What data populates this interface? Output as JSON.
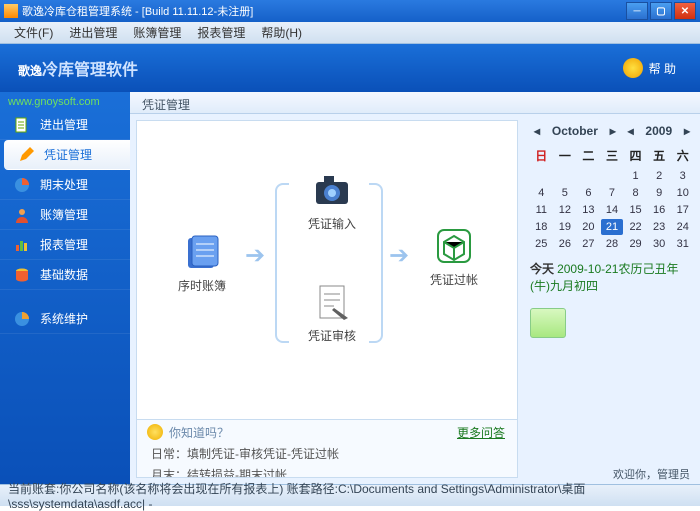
{
  "title": "歌逸冷库仓租管理系统 - [Build 11.11.12-未注册]",
  "menu": {
    "file": "文件(F)",
    "in": "进出管理",
    "book": "账簿管理",
    "report": "报表管理",
    "help": "帮助(H)"
  },
  "header": {
    "brand": "歌逸",
    "sub": "冷库管理软件",
    "help": "帮 助",
    "url": "www.gnoysoft.com"
  },
  "nav": {
    "items": [
      {
        "label": "进出管理"
      },
      {
        "label": "凭证管理"
      },
      {
        "label": "期末处理"
      },
      {
        "label": "账簿管理"
      },
      {
        "label": "报表管理"
      },
      {
        "label": "基础数据"
      },
      {
        "label": "系统维护"
      }
    ]
  },
  "crumb": "凭证管理",
  "flow": {
    "n1": "序时账簿",
    "n2": "凭证输入",
    "n3": "凭证审核",
    "n4": "凭证过帐"
  },
  "calendar": {
    "month": "October",
    "year": "2009",
    "dow": [
      "日",
      "一",
      "二",
      "三",
      "四",
      "五",
      "六"
    ],
    "days": [
      "",
      "",
      "",
      "",
      "1",
      "2",
      "3",
      "4",
      "5",
      "6",
      "7",
      "8",
      "9",
      "10",
      "11",
      "12",
      "13",
      "14",
      "15",
      "16",
      "17",
      "18",
      "19",
      "20",
      "21",
      "22",
      "23",
      "24",
      "25",
      "26",
      "27",
      "28",
      "29",
      "30",
      "31"
    ],
    "todayIndex": 24,
    "todayLabel": "今天",
    "todayText": "2009-10-21农历己丑年(牛)九月初四"
  },
  "info": {
    "q": "你知道吗？",
    "more": "更多问答",
    "l1": "日常：填制凭证-审核凭证-凭证过帐",
    "l2": "月末：结转损益-期末过帐"
  },
  "welcome": "欢迎你，管理员",
  "status": "当前账套:你公司名称(该名称将会出现在所有报表上) 账套路径:C:\\Documents and Settings\\Administrator\\桌面\\sss\\systemdata\\asdf.acc| -"
}
